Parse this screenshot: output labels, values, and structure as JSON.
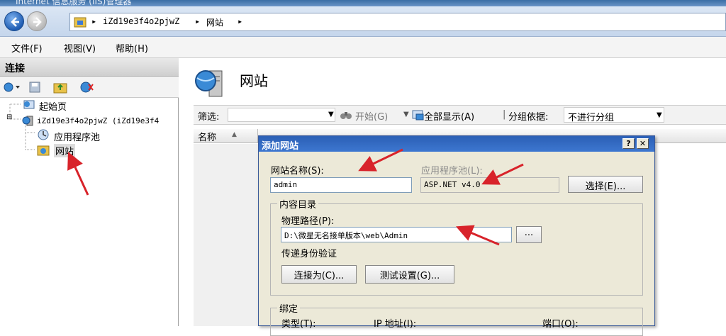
{
  "window": {
    "title": "Internet 信息服务 (IIS)管理器"
  },
  "address": {
    "crumbs": [
      "iZd19e3f4o2pjwZ",
      "网站"
    ],
    "sep": "▸"
  },
  "menu": {
    "items": [
      "文件(F)",
      "视图(V)",
      "帮助(H)"
    ]
  },
  "connections": {
    "header": "连接",
    "tree": {
      "start_page": "起始页",
      "server": "iZd19e3f4o2pjwZ (iZd19e3f4",
      "app_pools": "应用程序池",
      "sites": "网站",
      "collapse_glyph": "⊟"
    }
  },
  "content": {
    "title": "网站",
    "filter": {
      "label": "筛选:",
      "start": "开始(G)",
      "show_all": "全部显示(A)",
      "group_by_label": "分组依据:",
      "group_by_value": "不进行分组"
    },
    "list": {
      "col_name": "名称",
      "sort_glyph": "▲"
    }
  },
  "dialog": {
    "title": "添加网站",
    "help_glyph": "?",
    "close_glyph": "✕",
    "site_name_label": "网站名称(S):",
    "site_name_value": "admin",
    "app_pool_label": "应用程序池(L):",
    "app_pool_value": "ASP.NET v4.0",
    "select_button": "选择(E)...",
    "content_dir_title": "内容目录",
    "physical_path_label": "物理路径(P):",
    "physical_path_value": "D:\\微星无名接单版本\\web\\Admin",
    "browse_button": "...",
    "pass_auth_label": "传递身份验证",
    "connect_as_button": "连接为(C)...",
    "test_settings_button": "测试设置(G)...",
    "binding_title": "绑定",
    "type_label": "类型(T):",
    "ip_label": "IP 地址(I):",
    "port_label": "端口(O):"
  },
  "colors": {
    "annotation": "#d8232a",
    "title_blue": "#2b5fb5"
  },
  "icons": [
    "back-arrow-icon",
    "forward-arrow-icon",
    "folder-icon",
    "globe-server-icon",
    "start-page-icon",
    "app-pool-icon",
    "site-icon",
    "filter-icon",
    "show-all-icon"
  ]
}
